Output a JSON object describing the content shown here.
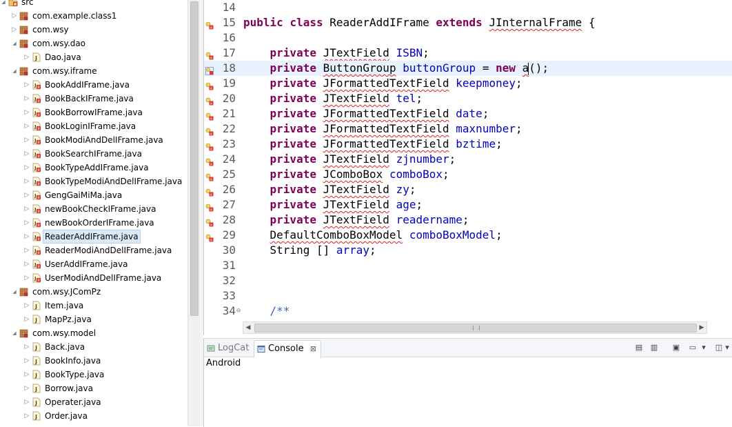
{
  "explorer": {
    "rows": [
      {
        "label": "src",
        "level": 0,
        "kind": "srcfolder",
        "expanded": true
      },
      {
        "label": "com.example.class1",
        "level": 1,
        "kind": "package",
        "expanded": false
      },
      {
        "label": "com.wsy",
        "level": 1,
        "kind": "package",
        "expanded": false
      },
      {
        "label": "com.wsy.dao",
        "level": 1,
        "kind": "package",
        "expanded": true
      },
      {
        "label": "Dao.java",
        "level": 2,
        "kind": "java",
        "expanded": false
      },
      {
        "label": "com.wsy.iframe",
        "level": 1,
        "kind": "package",
        "expanded": true
      },
      {
        "label": "BookAddIFrame.java",
        "level": 2,
        "kind": "java-err",
        "expanded": false
      },
      {
        "label": "BookBackIFrame.java",
        "level": 2,
        "kind": "java-err",
        "expanded": false
      },
      {
        "label": "BookBorrowIFrame.java",
        "level": 2,
        "kind": "java-err",
        "expanded": false
      },
      {
        "label": "BookLoginIFrame.java",
        "level": 2,
        "kind": "java-err",
        "expanded": false
      },
      {
        "label": "BookModiAndDelIFrame.java",
        "level": 2,
        "kind": "java-err",
        "expanded": false
      },
      {
        "label": "BookSearchIFrame.java",
        "level": 2,
        "kind": "java-err",
        "expanded": false
      },
      {
        "label": "BookTypeAddIFrame.java",
        "level": 2,
        "kind": "java-err",
        "expanded": false
      },
      {
        "label": "BookTypeModiAndDelIFrame.java",
        "level": 2,
        "kind": "java-err",
        "expanded": false
      },
      {
        "label": "GengGaiMiMa.java",
        "level": 2,
        "kind": "java-err",
        "expanded": false
      },
      {
        "label": "newBookCheckIFrame.java",
        "level": 2,
        "kind": "java-err",
        "expanded": false
      },
      {
        "label": "newBookOrderIFrame.java",
        "level": 2,
        "kind": "java-err",
        "expanded": false
      },
      {
        "label": "ReaderAddIFrame.java",
        "level": 2,
        "kind": "java-err",
        "expanded": false,
        "selected": true
      },
      {
        "label": "ReaderModiAndDelIFrame.java",
        "level": 2,
        "kind": "java-err",
        "expanded": false
      },
      {
        "label": "UserAddIFrame.java",
        "level": 2,
        "kind": "java-err",
        "expanded": false
      },
      {
        "label": "UserModiAndDelIFrame.java",
        "level": 2,
        "kind": "java-err",
        "expanded": false
      },
      {
        "label": "com.wsy.JComPz",
        "level": 1,
        "kind": "package",
        "expanded": true
      },
      {
        "label": "Item.java",
        "level": 2,
        "kind": "java",
        "expanded": false
      },
      {
        "label": "MapPz.java",
        "level": 2,
        "kind": "java",
        "expanded": false
      },
      {
        "label": "com.wsy.model",
        "level": 1,
        "kind": "package",
        "expanded": true
      },
      {
        "label": "Back.java",
        "level": 2,
        "kind": "java",
        "expanded": false
      },
      {
        "label": "BookInfo.java",
        "level": 2,
        "kind": "java",
        "expanded": false
      },
      {
        "label": "BookType.java",
        "level": 2,
        "kind": "java",
        "expanded": false
      },
      {
        "label": "Borrow.java",
        "level": 2,
        "kind": "java",
        "expanded": false
      },
      {
        "label": "Operater.java",
        "level": 2,
        "kind": "java",
        "expanded": false
      },
      {
        "label": "Order.java",
        "level": 2,
        "kind": "java",
        "expanded": false
      }
    ]
  },
  "editor": {
    "lines": [
      {
        "num": "14",
        "marker": "",
        "fold": "",
        "tokens": []
      },
      {
        "num": "15",
        "marker": "error",
        "fold": "",
        "tokens": [
          [
            "kw",
            "public"
          ],
          [
            "",
            " "
          ],
          [
            "kw",
            "class"
          ],
          [
            "",
            " ReaderAddIFrame "
          ],
          [
            "kw",
            "extends"
          ],
          [
            "",
            " "
          ],
          [
            "ty",
            "JInternalFrame"
          ],
          [
            "",
            " {"
          ]
        ]
      },
      {
        "num": "16",
        "marker": "",
        "fold": "",
        "tokens": []
      },
      {
        "num": "17",
        "marker": "error",
        "fold": "",
        "tokens": [
          [
            "",
            "    "
          ],
          [
            "kw",
            "private"
          ],
          [
            "",
            " "
          ],
          [
            "ty",
            "JTextField"
          ],
          [
            "",
            " "
          ],
          [
            "fd",
            "ISBN"
          ],
          [
            "",
            ";"
          ]
        ]
      },
      {
        "num": "18",
        "marker": "error-quickfix",
        "fold": "",
        "current": true,
        "tokens": [
          [
            "",
            "    "
          ],
          [
            "kw",
            "private"
          ],
          [
            "",
            " "
          ],
          [
            "ty",
            "ButtonGroup"
          ],
          [
            "",
            " "
          ],
          [
            "fd",
            "buttonGroup"
          ],
          [
            "",
            " = "
          ],
          [
            "kw",
            "new"
          ],
          [
            "",
            " "
          ],
          [
            "ty",
            "a"
          ],
          [
            "caret",
            ""
          ],
          [
            "",
            "();"
          ]
        ]
      },
      {
        "num": "19",
        "marker": "error",
        "fold": "",
        "tokens": [
          [
            "",
            "    "
          ],
          [
            "kw",
            "private"
          ],
          [
            "",
            " "
          ],
          [
            "ty",
            "JFormattedTextField"
          ],
          [
            "",
            " "
          ],
          [
            "fd",
            "keepmoney"
          ],
          [
            "",
            ";"
          ]
        ]
      },
      {
        "num": "20",
        "marker": "error",
        "fold": "",
        "tokens": [
          [
            "",
            "    "
          ],
          [
            "kw",
            "private"
          ],
          [
            "",
            " "
          ],
          [
            "ty",
            "JTextField"
          ],
          [
            "",
            " "
          ],
          [
            "fd",
            "tel"
          ],
          [
            "",
            ";"
          ]
        ]
      },
      {
        "num": "21",
        "marker": "error",
        "fold": "",
        "tokens": [
          [
            "",
            "    "
          ],
          [
            "kw",
            "private"
          ],
          [
            "",
            " "
          ],
          [
            "ty",
            "JFormattedTextField"
          ],
          [
            "",
            " "
          ],
          [
            "fd",
            "date"
          ],
          [
            "",
            ";"
          ]
        ]
      },
      {
        "num": "22",
        "marker": "error",
        "fold": "",
        "tokens": [
          [
            "",
            "    "
          ],
          [
            "kw",
            "private"
          ],
          [
            "",
            " "
          ],
          [
            "ty",
            "JFormattedTextField"
          ],
          [
            "",
            " "
          ],
          [
            "fd",
            "maxnumber"
          ],
          [
            "",
            ";"
          ]
        ]
      },
      {
        "num": "23",
        "marker": "error",
        "fold": "",
        "tokens": [
          [
            "",
            "    "
          ],
          [
            "kw",
            "private"
          ],
          [
            "",
            " "
          ],
          [
            "ty",
            "JFormattedTextField"
          ],
          [
            "",
            " "
          ],
          [
            "fd",
            "bztime"
          ],
          [
            "",
            ";"
          ]
        ]
      },
      {
        "num": "24",
        "marker": "error",
        "fold": "",
        "tokens": [
          [
            "",
            "    "
          ],
          [
            "kw",
            "private"
          ],
          [
            "",
            " "
          ],
          [
            "ty",
            "JTextField"
          ],
          [
            "",
            " "
          ],
          [
            "fd",
            "zjnumber"
          ],
          [
            "",
            ";"
          ]
        ]
      },
      {
        "num": "25",
        "marker": "error",
        "fold": "",
        "tokens": [
          [
            "",
            "    "
          ],
          [
            "kw",
            "private"
          ],
          [
            "",
            " "
          ],
          [
            "ty",
            "JComboBox"
          ],
          [
            "",
            " "
          ],
          [
            "fd",
            "comboBox"
          ],
          [
            "",
            ";"
          ]
        ]
      },
      {
        "num": "26",
        "marker": "error",
        "fold": "",
        "tokens": [
          [
            "",
            "    "
          ],
          [
            "kw",
            "private"
          ],
          [
            "",
            " "
          ],
          [
            "ty",
            "JTextField"
          ],
          [
            "",
            " "
          ],
          [
            "fd",
            "zy"
          ],
          [
            "",
            ";"
          ]
        ]
      },
      {
        "num": "27",
        "marker": "error",
        "fold": "",
        "tokens": [
          [
            "",
            "    "
          ],
          [
            "kw",
            "private"
          ],
          [
            "",
            " "
          ],
          [
            "ty",
            "JTextField"
          ],
          [
            "",
            " "
          ],
          [
            "fd",
            "age"
          ],
          [
            "",
            ";"
          ]
        ]
      },
      {
        "num": "28",
        "marker": "error",
        "fold": "",
        "tokens": [
          [
            "",
            "    "
          ],
          [
            "kw",
            "private"
          ],
          [
            "",
            " "
          ],
          [
            "ty",
            "JTextField"
          ],
          [
            "",
            " "
          ],
          [
            "fd",
            "readername"
          ],
          [
            "",
            ";"
          ]
        ]
      },
      {
        "num": "29",
        "marker": "error",
        "fold": "",
        "tokens": [
          [
            "",
            "    "
          ],
          [
            "ty",
            "DefaultComboBoxModel"
          ],
          [
            "",
            " "
          ],
          [
            "fd",
            "comboBoxModel"
          ],
          [
            "",
            ";"
          ]
        ]
      },
      {
        "num": "30",
        "marker": "",
        "fold": "",
        "tokens": [
          [
            "",
            "    String [] "
          ],
          [
            "fd",
            "array"
          ],
          [
            "",
            ";"
          ]
        ]
      },
      {
        "num": "31",
        "marker": "",
        "fold": "",
        "tokens": []
      },
      {
        "num": "32",
        "marker": "",
        "fold": "",
        "tokens": []
      },
      {
        "num": "33",
        "marker": "",
        "fold": "",
        "tokens": []
      },
      {
        "num": "34",
        "marker": "",
        "fold": "⊖",
        "tokens": [
          [
            "",
            "    "
          ],
          [
            "cm",
            "/**"
          ]
        ]
      }
    ]
  },
  "panel": {
    "tabs": [
      {
        "label": "LogCat",
        "active": false,
        "icon": "logcat-icon"
      },
      {
        "label": "Console",
        "active": true,
        "icon": "console-icon",
        "close": "⊠"
      }
    ],
    "console_text": "Android"
  },
  "colors": {
    "keyword": "#7f0055",
    "field": "#0000c0",
    "comment": "#3f5fbf",
    "error": "#e02020",
    "current_line": "#e8f2fe"
  }
}
